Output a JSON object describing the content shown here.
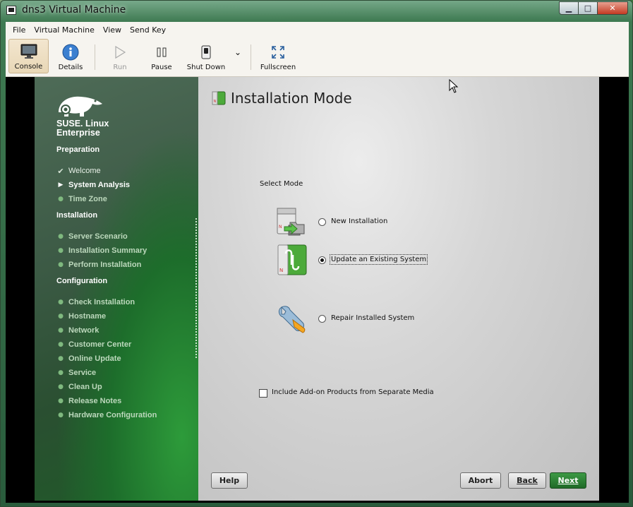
{
  "window": {
    "title": "dns3 Virtual Machine",
    "controls": {
      "minimize": "▁",
      "maximize": "□",
      "close": "✕"
    }
  },
  "menubar": [
    "File",
    "Virtual Machine",
    "View",
    "Send Key"
  ],
  "toolbar": {
    "console": "Console",
    "details": "Details",
    "run": "Run",
    "pause": "Pause",
    "shutdown": "Shut Down",
    "fullscreen": "Fullscreen"
  },
  "sidebar": {
    "brand_line1": "SUSE. Linux",
    "brand_line2": "Enterprise",
    "sections": {
      "preparation": "Preparation",
      "installation": "Installation",
      "configuration": "Configuration"
    },
    "preparation_items": [
      "Welcome",
      "System Analysis",
      "Time Zone"
    ],
    "installation_items": [
      "Server Scenario",
      "Installation Summary",
      "Perform Installation"
    ],
    "configuration_items": [
      "Check Installation",
      "Hostname",
      "Network",
      "Customer Center",
      "Online Update",
      "Service",
      "Clean Up",
      "Release Notes",
      "Hardware Configuration"
    ]
  },
  "content": {
    "title": "Installation Mode",
    "select_mode": "Select Mode",
    "options": [
      {
        "label": "New Installation",
        "checked": false
      },
      {
        "label": "Update an Existing System",
        "checked": true
      },
      {
        "label": "Repair Installed System",
        "checked": false
      }
    ],
    "addon_label": "Include Add-on Products from Separate Media",
    "buttons": {
      "help": "Help",
      "abort": "Abort",
      "back": "Back",
      "next": "Next"
    }
  },
  "colors": {
    "accent_green": "#2e8b3a",
    "sidebar_dark": "#2a4f31"
  }
}
